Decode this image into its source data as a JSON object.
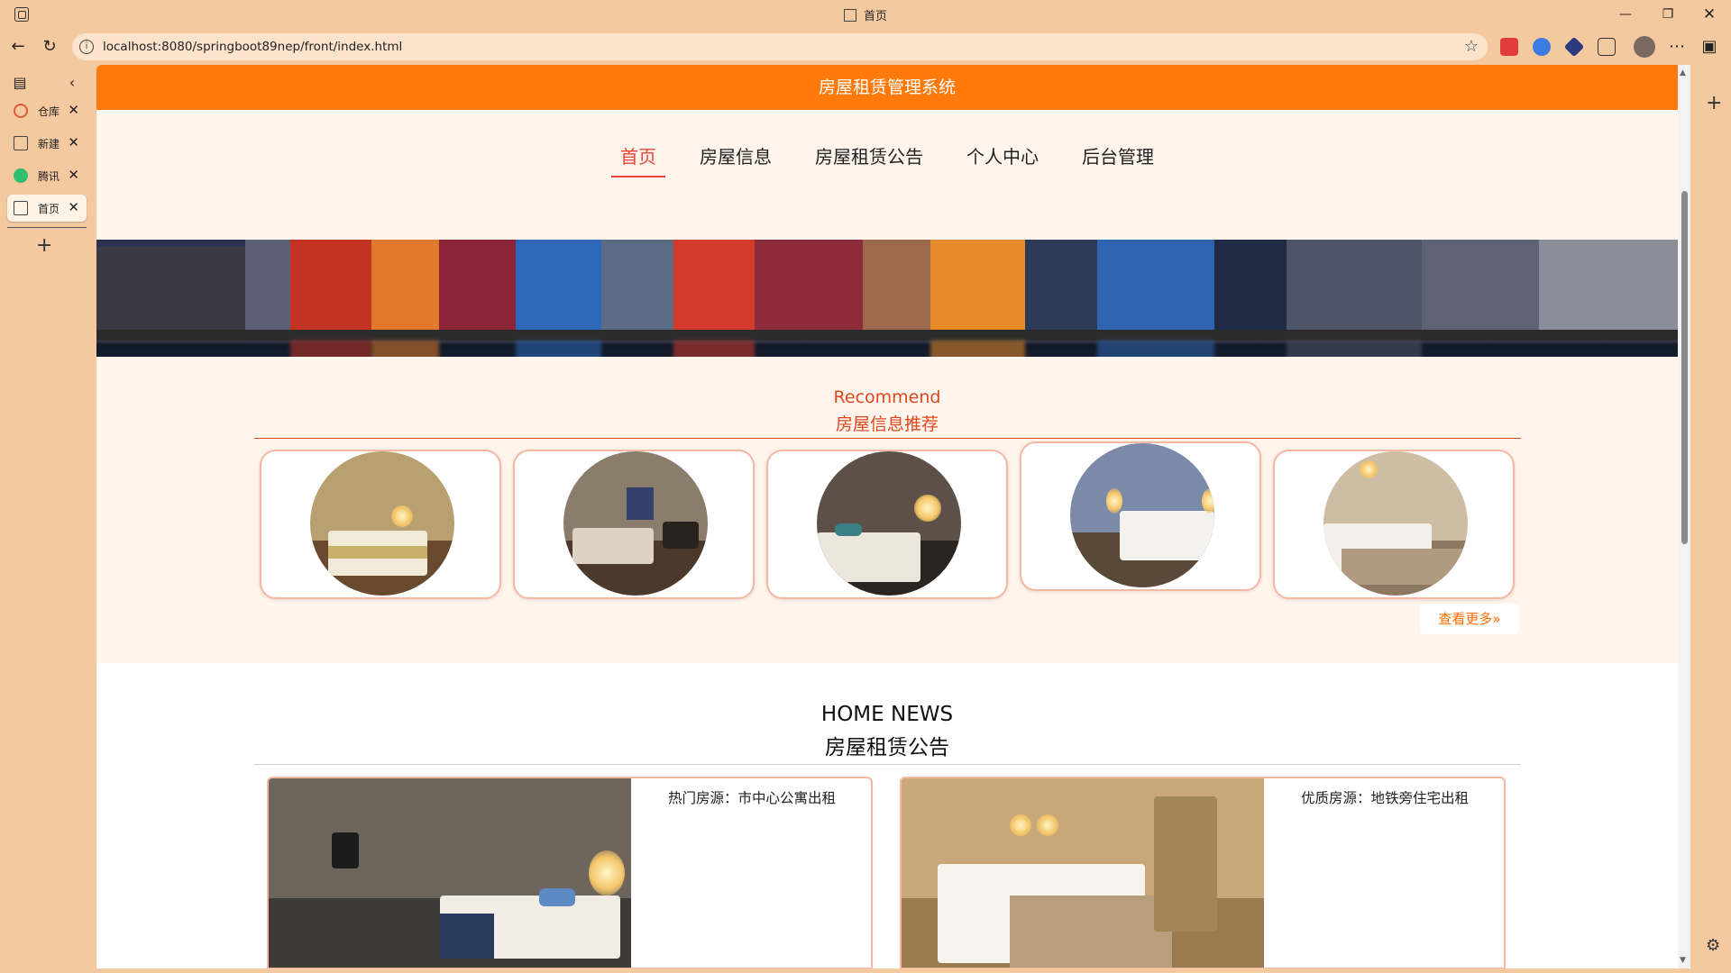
{
  "browser": {
    "tab_title": "首页",
    "url": "localhost:8080/springboot89nep/front/index.html",
    "vertical_tabs": [
      {
        "label": "仓库",
        "icon": "gitee-icon",
        "color": "#e05a3a"
      },
      {
        "label": "新建",
        "icon": "document-icon",
        "color": "#444444"
      },
      {
        "label": "腾讯",
        "icon": "tencent-icon",
        "color": "#2fbf71"
      },
      {
        "label": "首页",
        "icon": "image-icon",
        "color": "#444444"
      }
    ]
  },
  "site": {
    "header_title": "房屋租赁管理系统",
    "accent_color": "#ff7a0a",
    "nav": [
      {
        "label": "首页",
        "active": true
      },
      {
        "label": "房屋信息"
      },
      {
        "label": "房屋租赁公告"
      },
      {
        "label": "个人中心"
      },
      {
        "label": "后台管理"
      }
    ],
    "carousel": {
      "slide_count": 3,
      "active_index": 1
    }
  },
  "recommend": {
    "title_en": "Recommend",
    "title_cn": "房屋信息推荐",
    "title_color": "#e0471c",
    "more_label": "查看更多",
    "more_icon": "double-chevron-right-icon"
  },
  "news": {
    "title_en": "HOME NEWS",
    "title_cn": "房屋租赁公告",
    "items": [
      {
        "title": "热门房源：市中心公寓出租"
      },
      {
        "title": "优质房源：地铁旁住宅出租"
      }
    ]
  }
}
